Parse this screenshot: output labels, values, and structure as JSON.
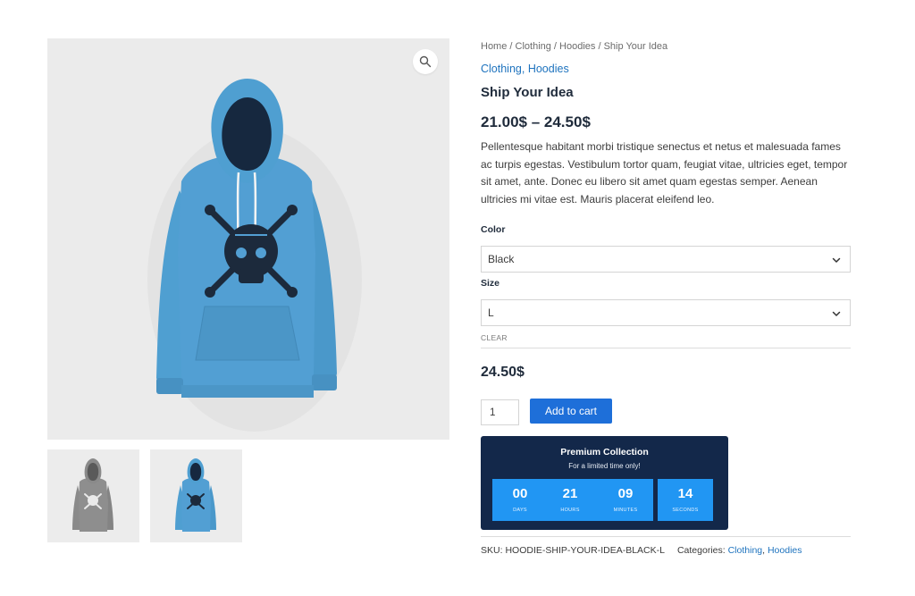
{
  "breadcrumb": {
    "items": [
      "Home",
      "Clothing",
      "Hoodies",
      "Ship Your Idea"
    ],
    "separator": " / "
  },
  "categories_top": [
    "Clothing",
    "Hoodies"
  ],
  "categories_sep": ", ",
  "product": {
    "title": "Ship Your Idea",
    "price_range": "21.00$ – 24.50$",
    "description": "Pellentesque habitant morbi tristique senectus et netus et malesuada fames ac turpis egestas. Vestibulum tortor quam, feugiat vitae, ultricies eget, tempor sit amet, ante. Donec eu libero sit amet quam egestas semper. Aenean ultricies mi vitae est. Mauris placerat eleifend leo."
  },
  "variations": {
    "color_label": "Color",
    "color_value": "Black",
    "size_label": "Size",
    "size_value": "L",
    "clear_label": "CLEAR"
  },
  "variation_price": "24.50$",
  "cart": {
    "quantity": "1",
    "add_label": "Add to cart"
  },
  "countdown": {
    "title": "Premium Collection",
    "subtitle": "For a limited time only!",
    "units": [
      {
        "value": "00",
        "label": "DAYS"
      },
      {
        "value": "21",
        "label": "HOURS"
      },
      {
        "value": "09",
        "label": "MINUTES"
      },
      {
        "value": "14",
        "label": "SECONDS"
      }
    ]
  },
  "meta": {
    "sku_label": "SKU:",
    "sku_value": "HOODIE-SHIP-YOUR-IDEA-BLACK-L",
    "categories_label": "Categories:",
    "categories": [
      "Clothing",
      "Hoodies"
    ]
  },
  "colors": {
    "link": "#1e73be",
    "button": "#1e6fd9",
    "countdown_bg": "#13284a",
    "countdown_box": "#2196f3",
    "hoodie_blue": "#4f9fd1"
  },
  "icons": {
    "zoom": "magnifier-icon",
    "select": "chevron-down-icon"
  }
}
